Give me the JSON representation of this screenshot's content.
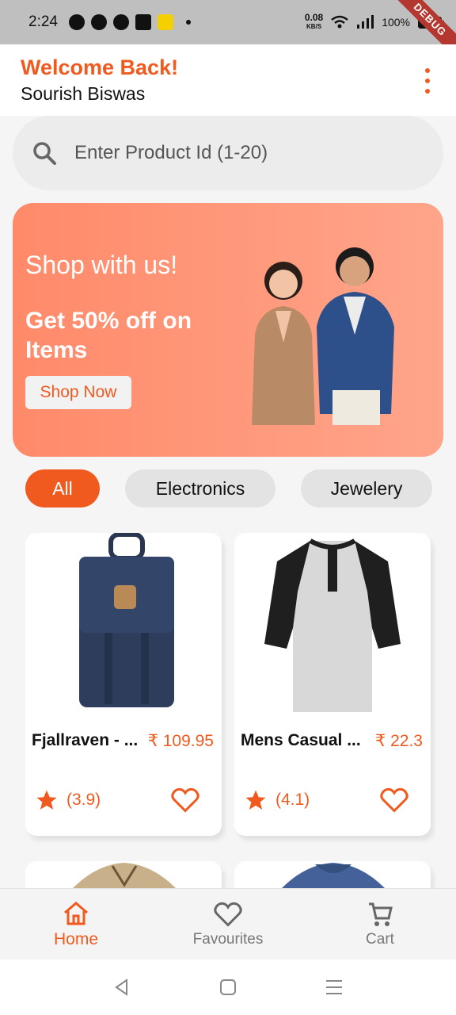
{
  "status_bar": {
    "time": "2:24",
    "net_speed": "0.08",
    "net_unit": "KB/S",
    "battery": "100%",
    "debug_label": "DEBUG"
  },
  "header": {
    "welcome": "Welcome Back!",
    "user_name": "Sourish Biswas",
    "menu_icon": "more-vertical-icon"
  },
  "search": {
    "placeholder": "Enter Product Id (1-20)",
    "icon": "search-icon"
  },
  "banner": {
    "tagline": "Shop with us!",
    "offer": "Get 50% off on Items",
    "button_label": "Shop Now"
  },
  "categories": [
    {
      "label": "All",
      "active": true
    },
    {
      "label": "Electronics",
      "active": false
    },
    {
      "label": "Jewelery",
      "active": false
    }
  ],
  "products": [
    {
      "title": "Fjallraven - ...",
      "price": "₹ 109.95",
      "rating": "(3.9)"
    },
    {
      "title": "Mens Casual ...",
      "price": "₹ 22.3",
      "rating": "(4.1)"
    }
  ],
  "bottom_nav": [
    {
      "label": "Home",
      "icon": "home-icon",
      "active": true
    },
    {
      "label": "Favourites",
      "icon": "heart-icon",
      "active": false
    },
    {
      "label": "Cart",
      "icon": "cart-icon",
      "active": false
    }
  ],
  "colors": {
    "accent": "#f05a1f",
    "banner": "#ff8a6a"
  }
}
